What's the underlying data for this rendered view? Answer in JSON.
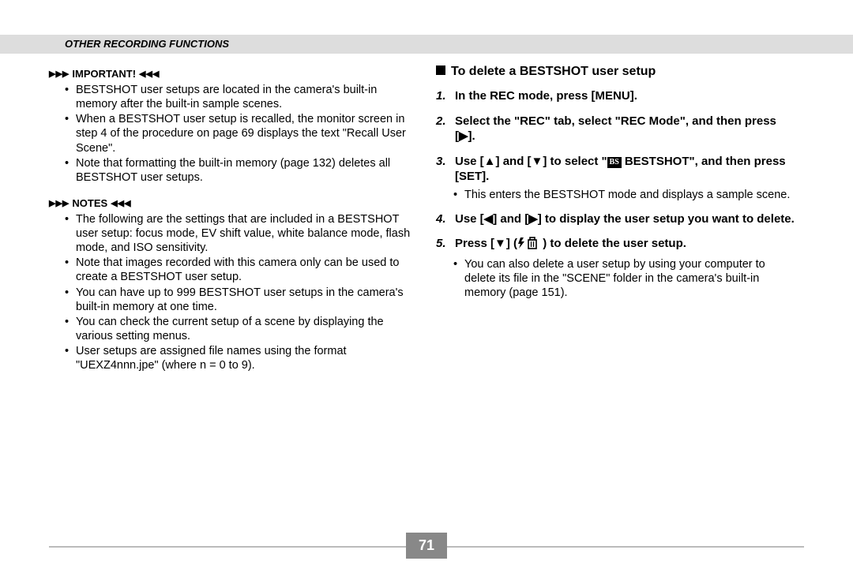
{
  "header": "OTHER RECORDING FUNCTIONS",
  "left": {
    "important_label": "IMPORTANT!",
    "important_items": [
      "BESTSHOT user setups are located in the camera's built-in memory after the built-in sample scenes.",
      "When a BESTSHOT user setup is recalled, the monitor screen in step 4 of the procedure on page 69 displays the text \"Recall User Scene\".",
      "Note that formatting the built-in memory (page 132) deletes all BESTSHOT user setups."
    ],
    "notes_label": "NOTES",
    "notes_items": [
      "The following are the settings that are included in a BESTSHOT user setup: focus mode, EV shift value, white balance mode, flash mode, and ISO sensitivity.",
      "Note that images recorded with this camera only can be used to create a BESTSHOT user setup.",
      "You can have up to 999 BESTSHOT user setups in the camera's built-in memory at one time.",
      "You can check the current setup of a scene by displaying the various setting menus.",
      "User setups are assigned file names using the format \"UEXZ4nnn.jpe\" (where n = 0 to 9)."
    ]
  },
  "right": {
    "heading": "To delete a BESTSHOT user setup",
    "steps": {
      "s1": "In the REC mode, press [MENU].",
      "s2": "Select the \"REC\" tab, select \"REC Mode\", and then press [▶].",
      "s3_a": "Use [▲] and [▼] to select \"",
      "s3_bs": "BS",
      "s3_b": " BESTSHOT\", and then press [SET].",
      "s3_sub": "This enters the BESTSHOT mode and displays a sample scene.",
      "s4": "Use [◀] and [▶] to display the user setup you want to delete.",
      "s5_a": "Press [▼] (",
      "s5_b": ") to delete the user setup.",
      "s5_sub": "You can also delete a user setup by using your computer to delete its file in the \"SCENE\" folder in the camera's built-in memory (page 151)."
    }
  },
  "page": "71"
}
